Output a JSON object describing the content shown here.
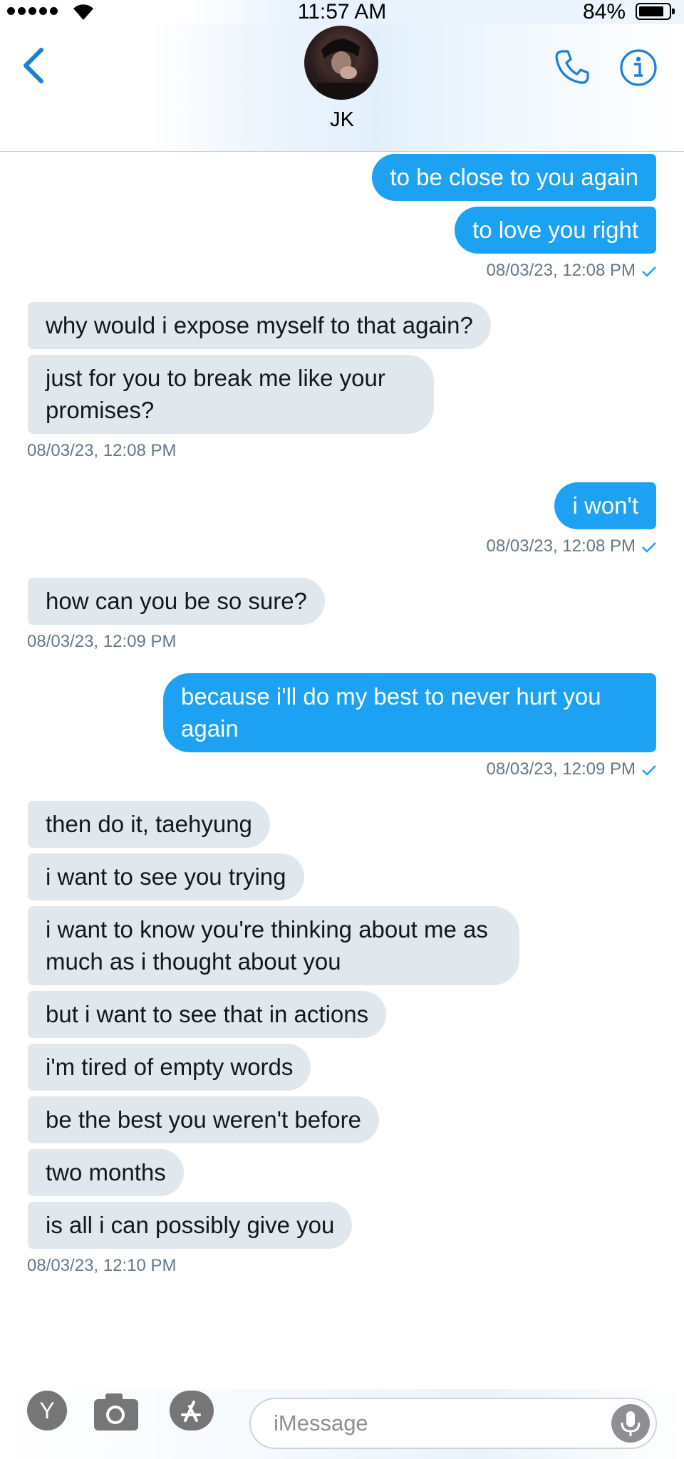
{
  "status_bar": {
    "time": "11:57 AM",
    "battery": "84%",
    "battery_level": 0.84
  },
  "header": {
    "contact_name": "JK",
    "back_icon": "chevron-left-icon",
    "call_icon": "phone-icon",
    "info_icon": "info-icon"
  },
  "messages": [
    {
      "dir": "out",
      "text": "to be close to you again"
    },
    {
      "dir": "out",
      "text": "to love you right"
    },
    {
      "stamp": "08/03/23, 12:08 PM",
      "dir": "out",
      "read": true
    },
    {
      "dir": "in",
      "text": "why would i expose myself to that again?"
    },
    {
      "dir": "in",
      "text": "just for you to break me like your promises?"
    },
    {
      "stamp": "08/03/23, 12:08 PM",
      "dir": "in"
    },
    {
      "dir": "out",
      "text": "i won't"
    },
    {
      "stamp": "08/03/23, 12:08 PM",
      "dir": "out",
      "read": true
    },
    {
      "dir": "in",
      "text": "how can you be so sure?"
    },
    {
      "stamp": "08/03/23, 12:09 PM",
      "dir": "in"
    },
    {
      "dir": "out",
      "text": "because i'll do my best to never hurt you again"
    },
    {
      "stamp": "08/03/23, 12:09 PM",
      "dir": "out",
      "read": true
    },
    {
      "dir": "in",
      "text": "then do it, taehyung"
    },
    {
      "dir": "in",
      "text": "i want to see you trying"
    },
    {
      "dir": "in",
      "text": "i want to know you're thinking about me as much as i thought about you"
    },
    {
      "dir": "in",
      "text": "but i want to see that in actions"
    },
    {
      "dir": "in",
      "text": "i'm tired of empty words"
    },
    {
      "dir": "in",
      "text": "be the best you weren't before"
    },
    {
      "dir": "in",
      "text": "two months"
    },
    {
      "dir": "in",
      "text": "is all i can possibly give you"
    },
    {
      "stamp": "08/03/23, 12:10 PM",
      "dir": "in"
    }
  ],
  "composer": {
    "y_button": "Y",
    "placeholder": "iMessage"
  },
  "colors": {
    "outgoing_bubble": "#1da1f2",
    "incoming_bubble": "#e1e8ed",
    "accent": "#1a7fd6",
    "timestamp": "#657786"
  }
}
